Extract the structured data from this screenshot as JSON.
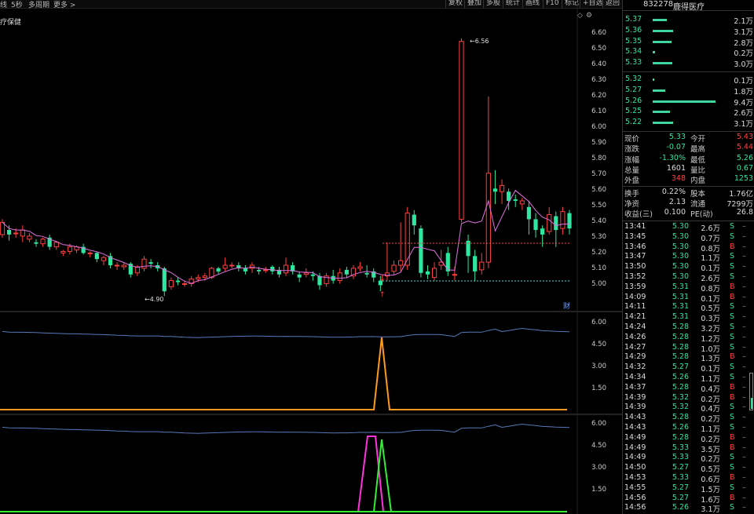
{
  "topbar": {
    "left_items": [
      "线",
      "5秒",
      "多周期",
      "更多 >"
    ],
    "right_items": [
      "复权",
      "叠加",
      "多股",
      "统计",
      "画线",
      "F10",
      "标记",
      "+自选",
      "返回"
    ]
  },
  "panel_title": "疗保健",
  "main_axis": [
    "6.60",
    "6.50",
    "6.40",
    "6.30",
    "6.20",
    "6.10",
    "6.00",
    "5.90",
    "5.80",
    "5.70",
    "5.60",
    "5.50",
    "5.40",
    "5.30",
    "5.20",
    "5.10",
    "5.00"
  ],
  "annotations": {
    "high": "6.56",
    "low": "4.90",
    "cai": "财"
  },
  "ind1_axis": [
    "6.00",
    "4.50",
    "3.00",
    "1.50"
  ],
  "ind2_axis": [
    "6.00",
    "4.50",
    "3.00",
    "1.50"
  ],
  "chart_data": {
    "type": "candlestick",
    "ylim": [
      4.88,
      6.62
    ],
    "candles": [
      [
        5.3,
        5.38,
        5.4,
        5.28
      ],
      [
        5.33,
        5.3,
        5.36,
        5.26
      ],
      [
        5.31,
        5.31,
        5.34,
        5.28
      ],
      [
        5.29,
        5.33,
        5.36,
        5.25
      ],
      [
        5.27,
        5.29,
        5.31,
        5.25
      ],
      [
        5.25,
        5.24,
        5.27,
        5.22
      ],
      [
        5.24,
        5.27,
        5.28,
        5.22
      ],
      [
        5.28,
        5.22,
        5.3,
        5.2
      ],
      [
        5.22,
        5.25,
        5.26,
        5.2
      ],
      [
        5.18,
        5.19,
        5.2,
        5.16
      ],
      [
        5.19,
        5.22,
        5.24,
        5.17
      ],
      [
        5.2,
        5.22,
        5.23,
        5.18
      ],
      [
        5.22,
        5.18,
        5.24,
        5.17
      ],
      [
        5.18,
        5.18,
        5.19,
        5.15
      ],
      [
        5.18,
        5.14,
        5.19,
        5.12
      ],
      [
        5.13,
        5.15,
        5.16,
        5.1
      ],
      [
        5.16,
        5.1,
        5.18,
        5.08
      ],
      [
        5.1,
        5.1,
        5.12,
        5.07
      ],
      [
        5.09,
        5.1,
        5.12,
        5.07
      ],
      [
        5.11,
        5.04,
        5.12,
        5.02
      ],
      [
        5.05,
        5.09,
        5.1,
        5.03
      ],
      [
        5.08,
        5.14,
        5.16,
        5.06
      ],
      [
        5.12,
        5.11,
        5.14,
        5.08
      ],
      [
        5.1,
        5.08,
        5.12,
        5.06
      ],
      [
        5.08,
        4.93,
        5.09,
        4.9
      ],
      [
        4.96,
        5.0,
        5.02,
        4.94
      ],
      [
        5.0,
        4.99,
        5.02,
        4.97
      ],
      [
        4.98,
        4.98,
        5.0,
        4.96
      ],
      [
        4.98,
        5.01,
        5.03,
        4.96
      ],
      [
        5.01,
        5.02,
        5.04,
        4.99
      ],
      [
        5.02,
        5.03,
        5.05,
        5.0
      ],
      [
        5.02,
        5.08,
        5.09,
        5.01
      ],
      [
        5.08,
        5.06,
        5.09,
        5.04
      ],
      [
        5.08,
        5.1,
        5.15,
        5.06
      ],
      [
        5.1,
        5.1,
        5.12,
        5.08
      ],
      [
        5.1,
        5.08,
        5.12,
        5.06
      ],
      [
        5.08,
        5.06,
        5.1,
        5.04
      ],
      [
        5.08,
        5.1,
        5.12,
        5.05
      ],
      [
        5.07,
        5.06,
        5.09,
        5.04
      ],
      [
        5.07,
        5.07,
        5.09,
        5.05
      ],
      [
        5.09,
        5.06,
        5.1,
        5.04
      ],
      [
        5.07,
        5.04,
        5.09,
        5.02
      ],
      [
        5.05,
        5.1,
        5.15,
        5.03
      ],
      [
        5.1,
        5.06,
        5.12,
        5.04
      ],
      [
        5.04,
        5.02,
        5.06,
        4.99
      ],
      [
        5.04,
        5.05,
        5.08,
        5.02
      ],
      [
        5.04,
        5.03,
        5.06,
        5.0
      ],
      [
        5.03,
        4.97,
        5.05,
        4.94
      ],
      [
        4.98,
        5.03,
        5.05,
        4.96
      ],
      [
        5.03,
        5.0,
        5.07,
        4.98
      ],
      [
        5.0,
        5.05,
        5.08,
        4.98
      ],
      [
        5.07,
        5.04,
        5.09,
        5.02
      ],
      [
        5.03,
        5.08,
        5.1,
        5.01
      ],
      [
        5.08,
        5.09,
        5.12,
        5.06
      ],
      [
        5.05,
        5.04,
        5.1,
        5.02
      ],
      [
        5.06,
        5.02,
        5.08,
        4.99
      ],
      [
        5.0,
        4.97,
        5.03,
        4.93
      ],
      [
        5.03,
        5.05,
        5.25,
        5.0
      ],
      [
        5.06,
        5.1,
        5.13,
        5.04
      ],
      [
        5.1,
        5.13,
        5.38,
        5.06
      ],
      [
        5.1,
        5.44,
        5.48,
        5.07
      ],
      [
        5.43,
        5.36,
        5.46,
        5.3
      ],
      [
        5.34,
        5.05,
        5.36,
        5.02
      ],
      [
        5.06,
        5.04,
        5.1,
        5.01
      ],
      [
        5.02,
        5.08,
        5.12,
        5.0
      ],
      [
        5.1,
        5.12,
        5.2,
        5.07
      ],
      [
        5.18,
        5.06,
        5.22,
        5.03
      ],
      [
        5.04,
        5.04,
        5.09,
        5.0
      ],
      [
        5.4,
        6.56,
        6.58,
        5.38
      ],
      [
        5.26,
        5.16,
        5.3,
        5.05
      ],
      [
        5.16,
        5.06,
        5.2,
        5.0
      ],
      [
        5.07,
        5.12,
        5.18,
        5.04
      ],
      [
        5.12,
        5.7,
        6.2,
        5.08
      ],
      [
        5.6,
        5.58,
        5.72,
        5.5
      ],
      [
        5.58,
        5.62,
        5.66,
        5.5
      ],
      [
        5.58,
        5.52,
        5.6,
        5.46
      ],
      [
        5.53,
        5.52,
        5.56,
        5.48
      ],
      [
        5.5,
        5.52,
        5.54,
        5.46
      ],
      [
        5.48,
        5.4,
        5.52,
        5.3
      ],
      [
        5.4,
        5.33,
        5.44,
        5.28
      ],
      [
        5.34,
        5.3,
        5.36,
        5.22
      ],
      [
        5.32,
        5.43,
        5.48,
        5.3
      ],
      [
        5.42,
        5.33,
        5.45,
        5.22
      ],
      [
        5.34,
        5.45,
        5.48,
        5.3
      ],
      [
        5.44,
        5.34,
        5.46,
        5.3
      ]
    ]
  },
  "stock": {
    "code": "832278",
    "name": "鹿得医疗"
  },
  "orderbook": {
    "asks": [
      {
        "price": "5.37",
        "vol": "2.1万",
        "w": 0.18
      },
      {
        "price": "5.36",
        "vol": "3.1万",
        "w": 0.26
      },
      {
        "price": "5.35",
        "vol": "2.8万",
        "w": 0.24
      },
      {
        "price": "5.34",
        "vol": "0.2万",
        "w": 0.03
      },
      {
        "price": "5.33",
        "vol": "3.0万",
        "w": 0.25
      }
    ],
    "bids": [
      {
        "price": "5.32",
        "vol": "0.1万",
        "w": 0.02
      },
      {
        "price": "5.27",
        "vol": "1.8万",
        "w": 0.16
      },
      {
        "price": "5.26",
        "vol": "9.4万",
        "w": 0.8
      },
      {
        "price": "5.25",
        "vol": "2.6万",
        "w": 0.22
      },
      {
        "price": "5.22",
        "vol": "3.1万",
        "w": 0.26
      }
    ]
  },
  "quote": [
    {
      "l1": "现价",
      "v1": "5.33",
      "c1": "green",
      "l2": "今开",
      "v2": "5.43",
      "c2": "red"
    },
    {
      "l1": "涨跌",
      "v1": "-0.07",
      "c1": "green",
      "l2": "最高",
      "v2": "5.44",
      "c2": "red"
    },
    {
      "l1": "涨幅",
      "v1": "-1.30%",
      "c1": "green",
      "l2": "最低",
      "v2": "5.26",
      "c2": "green"
    },
    {
      "l1": "总量",
      "v1": "1601",
      "c1": "",
      "l2": "量比",
      "v2": "0.67",
      "c2": "green"
    },
    {
      "l1": "外盘",
      "v1": "348",
      "c1": "red",
      "l2": "内盘",
      "v2": "1253",
      "c2": "green"
    },
    {
      "l1": "换手",
      "v1": "0.22%",
      "c1": "",
      "l2": "股本",
      "v2": "1.76亿",
      "c2": ""
    },
    {
      "l1": "净资",
      "v1": "2.13",
      "c1": "",
      "l2": "流通",
      "v2": "7299万",
      "c2": ""
    },
    {
      "l1": "收益(三)",
      "v1": "0.100",
      "c1": "",
      "l2": "PE(动)",
      "v2": "26.8",
      "c2": ""
    }
  ],
  "trades": [
    {
      "t": "13:41",
      "p": "5.30",
      "v": "2.6万",
      "s": "S"
    },
    {
      "t": "13:45",
      "p": "5.30",
      "v": "0.7万",
      "s": "S"
    },
    {
      "t": "13:46",
      "p": "5.30",
      "v": "0.8万",
      "s": "B"
    },
    {
      "t": "13:47",
      "p": "5.30",
      "v": "1.1万",
      "s": "S"
    },
    {
      "t": "13:50",
      "p": "5.30",
      "v": "0.1万",
      "s": "S"
    },
    {
      "t": "13:52",
      "p": "5.30",
      "v": "2.6万",
      "s": "S"
    },
    {
      "t": "13:59",
      "p": "5.31",
      "v": "0.8万",
      "s": "B"
    },
    {
      "t": "14:09",
      "p": "5.31",
      "v": "0.1万",
      "s": "B"
    },
    {
      "t": "14:11",
      "p": "5.31",
      "v": "0.5万",
      "s": "S"
    },
    {
      "t": "14:21",
      "p": "5.31",
      "v": "0.3万",
      "s": "S"
    },
    {
      "t": "14:24",
      "p": "5.28",
      "v": "3.2万",
      "s": "S"
    },
    {
      "t": "14:26",
      "p": "5.28",
      "v": "1.2万",
      "s": "S"
    },
    {
      "t": "14:27",
      "p": "5.28",
      "v": "1.0万",
      "s": "S"
    },
    {
      "t": "14:29",
      "p": "5.28",
      "v": "1.3万",
      "s": "B"
    },
    {
      "t": "14:32",
      "p": "5.27",
      "v": "0.1万",
      "s": "S"
    },
    {
      "t": "14:34",
      "p": "5.26",
      "v": "1.1万",
      "s": "S"
    },
    {
      "t": "14:37",
      "p": "5.28",
      "v": "0.4万",
      "s": "B"
    },
    {
      "t": "14:39",
      "p": "5.32",
      "v": "0.2万",
      "s": "B"
    },
    {
      "t": "14:39",
      "p": "5.32",
      "v": "0.4万",
      "s": "S"
    },
    {
      "t": "14:43",
      "p": "5.28",
      "v": "0.2万",
      "s": "S"
    },
    {
      "t": "14:43",
      "p": "5.26",
      "v": "1.1万",
      "s": "S"
    },
    {
      "t": "14:49",
      "p": "5.28",
      "v": "0.2万",
      "s": "B"
    },
    {
      "t": "14:49",
      "p": "5.33",
      "v": "3.5万",
      "s": "B"
    },
    {
      "t": "14:49",
      "p": "5.33",
      "v": "0.2万",
      "s": "S"
    },
    {
      "t": "14:50",
      "p": "5.27",
      "v": "0.5万",
      "s": "S"
    },
    {
      "t": "14:53",
      "p": "5.33",
      "v": "0.6万",
      "s": "B"
    },
    {
      "t": "14:55",
      "p": "5.27",
      "v": "1.5万",
      "s": "S"
    },
    {
      "t": "14:56",
      "p": "5.27",
      "v": "1.6万",
      "s": "B"
    },
    {
      "t": "14:56",
      "p": "5.26",
      "v": "3.1万",
      "s": "S"
    }
  ],
  "colors": {
    "up": "#ff4040",
    "down": "#2ee6a0",
    "ma": "#e070e0",
    "ind_line": "#5878b8",
    "orange": "#ff9a1a",
    "magenta": "#ff33dd",
    "lime": "#33ee33"
  }
}
